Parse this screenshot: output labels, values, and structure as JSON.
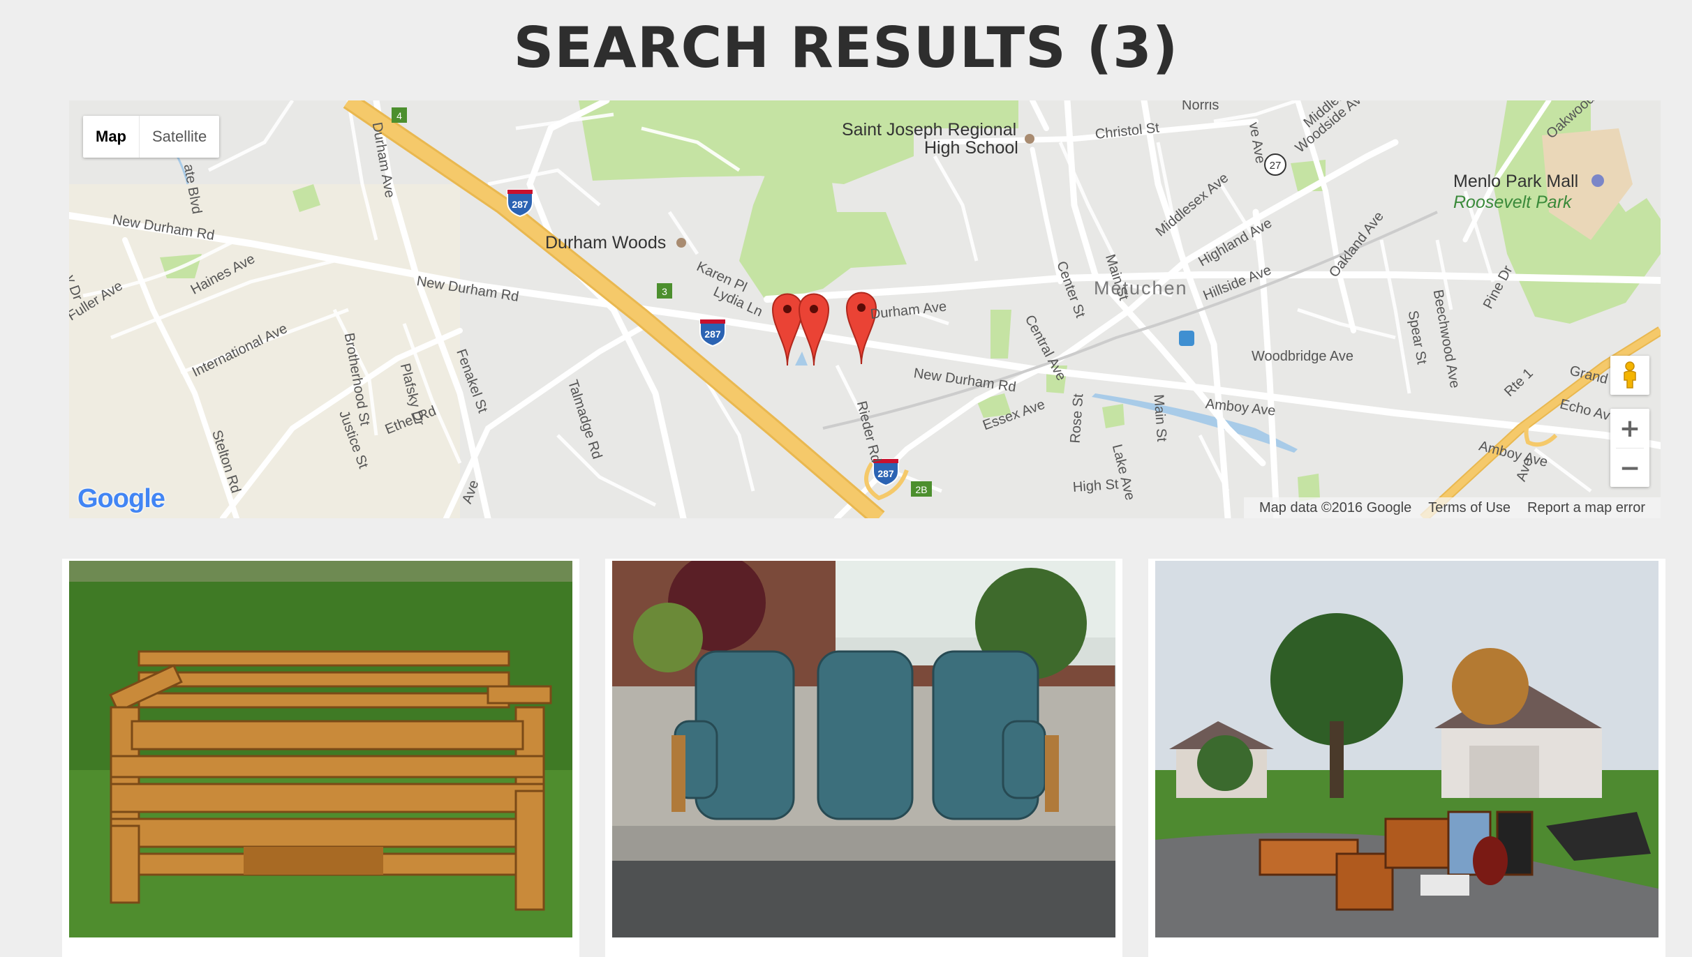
{
  "page": {
    "title": "SEARCH RESULTS (3)"
  },
  "map": {
    "type_control": {
      "map_label": "Map",
      "satellite_label": "Satellite",
      "active": "Map"
    },
    "labels": {
      "saint_joseph_line1": "Saint Joseph Regional",
      "saint_joseph_line2": "High School",
      "durham_woods": "Durham Woods",
      "metuchen": "Metuchen",
      "menlo_park_mall": "Menlo Park Mall",
      "roosevelt_park": "Roosevelt Park",
      "new_durham_rd_1": "New Durham Rd",
      "new_durham_rd_2": "New Durham Rd",
      "new_durham_rd_3": "New Durham Rd",
      "durham_ave_1": "Durham Ave",
      "durham_ave_2": "Durham Ave",
      "karen_pl": "Karen Pl",
      "lydia_ln": "Lydia Ln",
      "talmadge_rd": "Talmadge Rd",
      "ethel_rd": "Ethel Rd",
      "stelton_rd": "Stelton Rd",
      "justice_st": "Justice St",
      "plafsky_dr": "Plafsky Dr",
      "fenakel_st": "Fenakel St",
      "brotherhood_st": "Brotherhood St",
      "international_ave": "International Ave",
      "haines_ave": "Haines Ave",
      "fuller_ave": "Fuller Ave",
      "rieder_rd": "Rieder Rd",
      "essex_ave": "Essex Ave",
      "central_ave": "Central Ave",
      "center_st": "Center St",
      "main_st_1": "Main St",
      "main_st_2": "Main St",
      "middlesex_ave": "Middlesex Ave",
      "highland_ave": "Highland Ave",
      "hillside_ave": "Hillside Ave",
      "christol_st": "Christol St",
      "woodside_ave": "Woodside Ave",
      "oakland_ave": "Oakland Ave",
      "spear_st": "Spear St",
      "beechwood_ave": "Beechwood Ave",
      "pine_dr": "Pine Dr",
      "oakwood_ave": "Oakwood Ave",
      "woodbridge_ave": "Woodbridge Ave",
      "amboy_ave_1": "Amboy Ave",
      "amboy_ave_2": "Amboy Ave",
      "rte_1": "Rte 1",
      "grand": "Grand",
      "echo_av": "Echo Av",
      "rose_st": "Rose St",
      "lake_ave": "Lake Ave",
      "high_st": "High St",
      "state_blvd": "ate Blvd",
      "ave_1": "Ave",
      "ve_ave": "ve Ave",
      "middles": "Middles",
      "ave_2": "Ave",
      "y_dr": "y Dr",
      "norris": "Norris"
    },
    "shields": {
      "i287_a": "287",
      "i287_b": "287",
      "i287_c": "287",
      "exit_4": "4",
      "exit_3": "3",
      "exit_2b": "2B",
      "route_27": "27"
    },
    "markers": [
      {
        "name": "result-marker-1"
      },
      {
        "name": "result-marker-2"
      },
      {
        "name": "result-marker-3"
      }
    ],
    "logo": "Google",
    "attribution": {
      "map_data": "Map data ©2016 Google",
      "terms": "Terms of Use",
      "report": "Report a map error"
    },
    "zoom": {
      "in_label": "+",
      "out_label": "−"
    },
    "colors": {
      "background": "#e8e8e6",
      "road": "#ffffff",
      "highway": "#f5c96a",
      "park": "#c5e3a3",
      "water": "#a8cbe8",
      "marker": "#ea4335"
    }
  },
  "results": [
    {
      "image_description": "wooden pallet bench on grass"
    },
    {
      "image_description": "three blue recliner chairs on sidewalk"
    },
    {
      "image_description": "discarded furniture on lawn by street"
    }
  ]
}
